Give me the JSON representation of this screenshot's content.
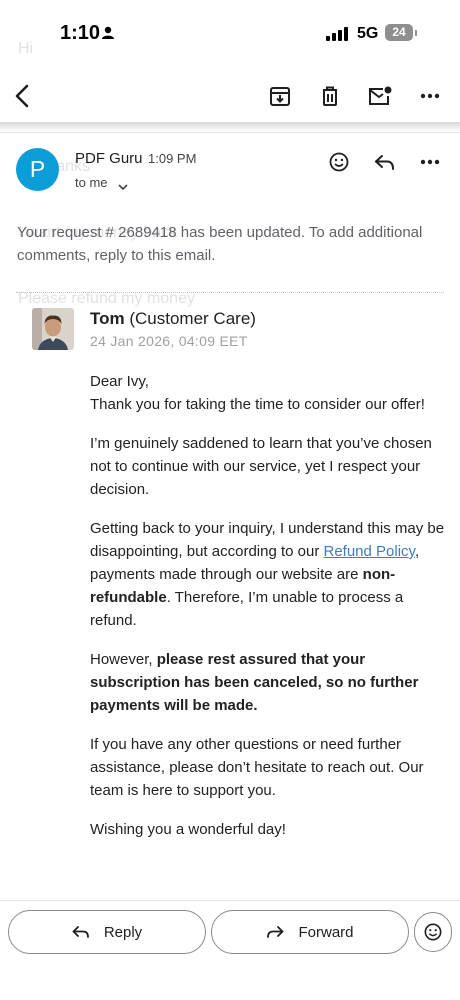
{
  "background_text": [
    "Hi",
    "No thanks",
    "I want my money back",
    "Please refund my money"
  ],
  "status_bar": {
    "time": "1:10",
    "network": "5G",
    "battery": "24"
  },
  "toolbar": {
    "back_icon": "chevron-left-icon",
    "archive_icon": "archive-icon",
    "delete_icon": "trash-icon",
    "mark_unread_icon": "mail-unread-icon",
    "more_icon": "more-horizontal-icon"
  },
  "email": {
    "sender_initial": "P",
    "sender_name": "PDF Guru",
    "time": "1:09 PM",
    "recipient": "to me",
    "intro": "Your request # 2689418 has been updated. To add additional comments, reply to this email.",
    "agent_name": "Tom",
    "agent_role": "(Customer Care)",
    "agent_date": "24 Jan 2026, 04:09 EET",
    "body": {
      "greeting": "Dear Ivy,",
      "thanks": "Thank you for taking the time to consider our offer!",
      "p1": "I’m genuinely saddened to learn that you’ve chosen not to continue with our service, yet I respect your decision.",
      "p2_a": "Getting back to your inquiry, I understand this may be disappointing, but according to our ",
      "p2_link": "Refund Policy",
      "p2_b": ", payments made through our website are ",
      "p2_bold": "non-refundable",
      "p2_c": ". Therefore, I’m unable to process a refund.",
      "p3_a": "However, ",
      "p3_bold": "please rest assured that your subscription has been canceled, so no further payments will be made.",
      "p4": "If you have any other questions or need further assistance, please don’t hesitate to reach out. Our team is here to support you.",
      "p5": "Wishing you a wonderful day!"
    }
  },
  "actions": {
    "reply_label": "Reply",
    "forward_label": "Forward"
  },
  "colors": {
    "avatar": "#0a9ed9",
    "link": "#3b7cc4"
  }
}
